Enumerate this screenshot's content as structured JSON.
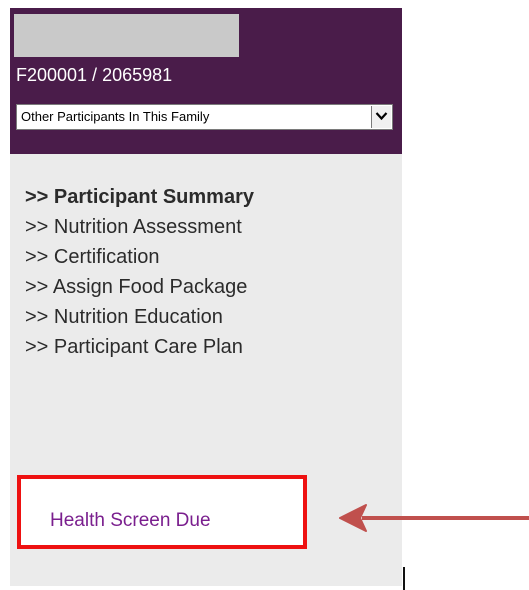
{
  "header": {
    "participant_id": "F200001 / 2065981",
    "family_select": {
      "selected": "Other Participants In This Family"
    }
  },
  "nav": {
    "items": [
      {
        "label": ">> Participant Summary",
        "active": true
      },
      {
        "label": ">> Nutrition Assessment",
        "active": false
      },
      {
        "label": ">> Certification",
        "active": false
      },
      {
        "label": ">> Assign Food Package",
        "active": false
      },
      {
        "label": ">> Nutrition Education",
        "active": false
      },
      {
        "label": ">> Participant Care Plan",
        "active": false
      }
    ]
  },
  "alert": {
    "label": "Health Screen Due"
  },
  "colors": {
    "header_bg": "#4a1c4a",
    "sidebar_bg": "#ebebeb",
    "alert_border": "#ee1111",
    "alert_link": "#7a1f8e",
    "annotation_arrow": "#c0504d"
  }
}
